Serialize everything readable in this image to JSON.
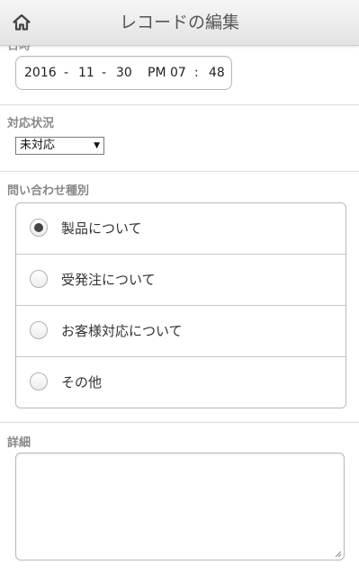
{
  "header": {
    "title": "レコードの編集",
    "home_icon": "home-icon"
  },
  "datetime_section": {
    "label_partial": "日時",
    "year": "2016",
    "sep1": "-",
    "month": "11",
    "sep2": "-",
    "day": "30",
    "ampm": "PM",
    "hour": "07",
    "colon": ":",
    "minute": "48"
  },
  "status_section": {
    "label": "対応状況",
    "selected": "未対応",
    "dropdown_icon": "triangle-down-icon"
  },
  "inquiry_section": {
    "label": "問い合わせ種別",
    "options": [
      {
        "label": "製品について",
        "checked": true
      },
      {
        "label": "受発注について",
        "checked": false
      },
      {
        "label": "お客様対応について",
        "checked": false
      },
      {
        "label": "その他",
        "checked": false
      }
    ]
  },
  "detail_section": {
    "label": "詳細",
    "value": ""
  }
}
